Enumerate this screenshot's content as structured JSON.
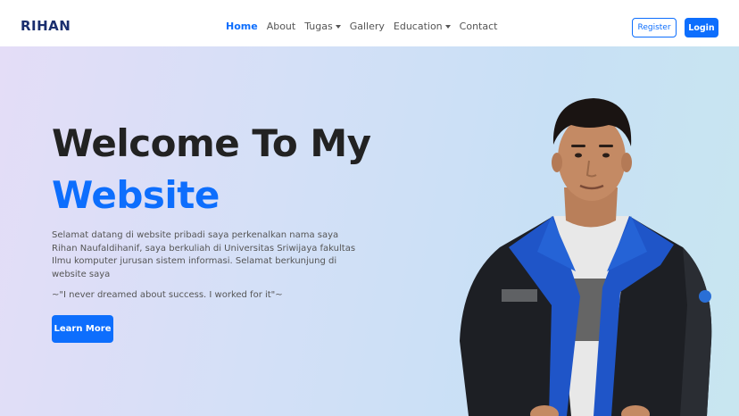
{
  "nav": {
    "brand": "RIHAN",
    "links": [
      {
        "label": "Home",
        "active": true
      },
      {
        "label": "About"
      },
      {
        "label": "Tugas",
        "dropdown": true
      },
      {
        "label": "Gallery"
      },
      {
        "label": "Education",
        "dropdown": true
      },
      {
        "label": "Contact"
      }
    ],
    "register_label": "Register",
    "login_label": "Login"
  },
  "hero": {
    "title_line1": "Welcome To My",
    "title_line2": "Website",
    "description": "Selamat datang di website pribadi saya perkenalkan nama saya Rihan Naufaldihanif, saya berkuliah di Universitas Sriwijaya fakultas Ilmu komputer jurusan sistem informasi. Selamat berkunjung di website saya",
    "quote": "~\"I never dreamed about success. I worked for it\"~",
    "button_label": "Learn More",
    "photo_icon": "person-portrait"
  },
  "colors": {
    "primary": "#0d6efd",
    "brand": "#1a2e6e",
    "title": "#222222",
    "text": "#555555"
  }
}
